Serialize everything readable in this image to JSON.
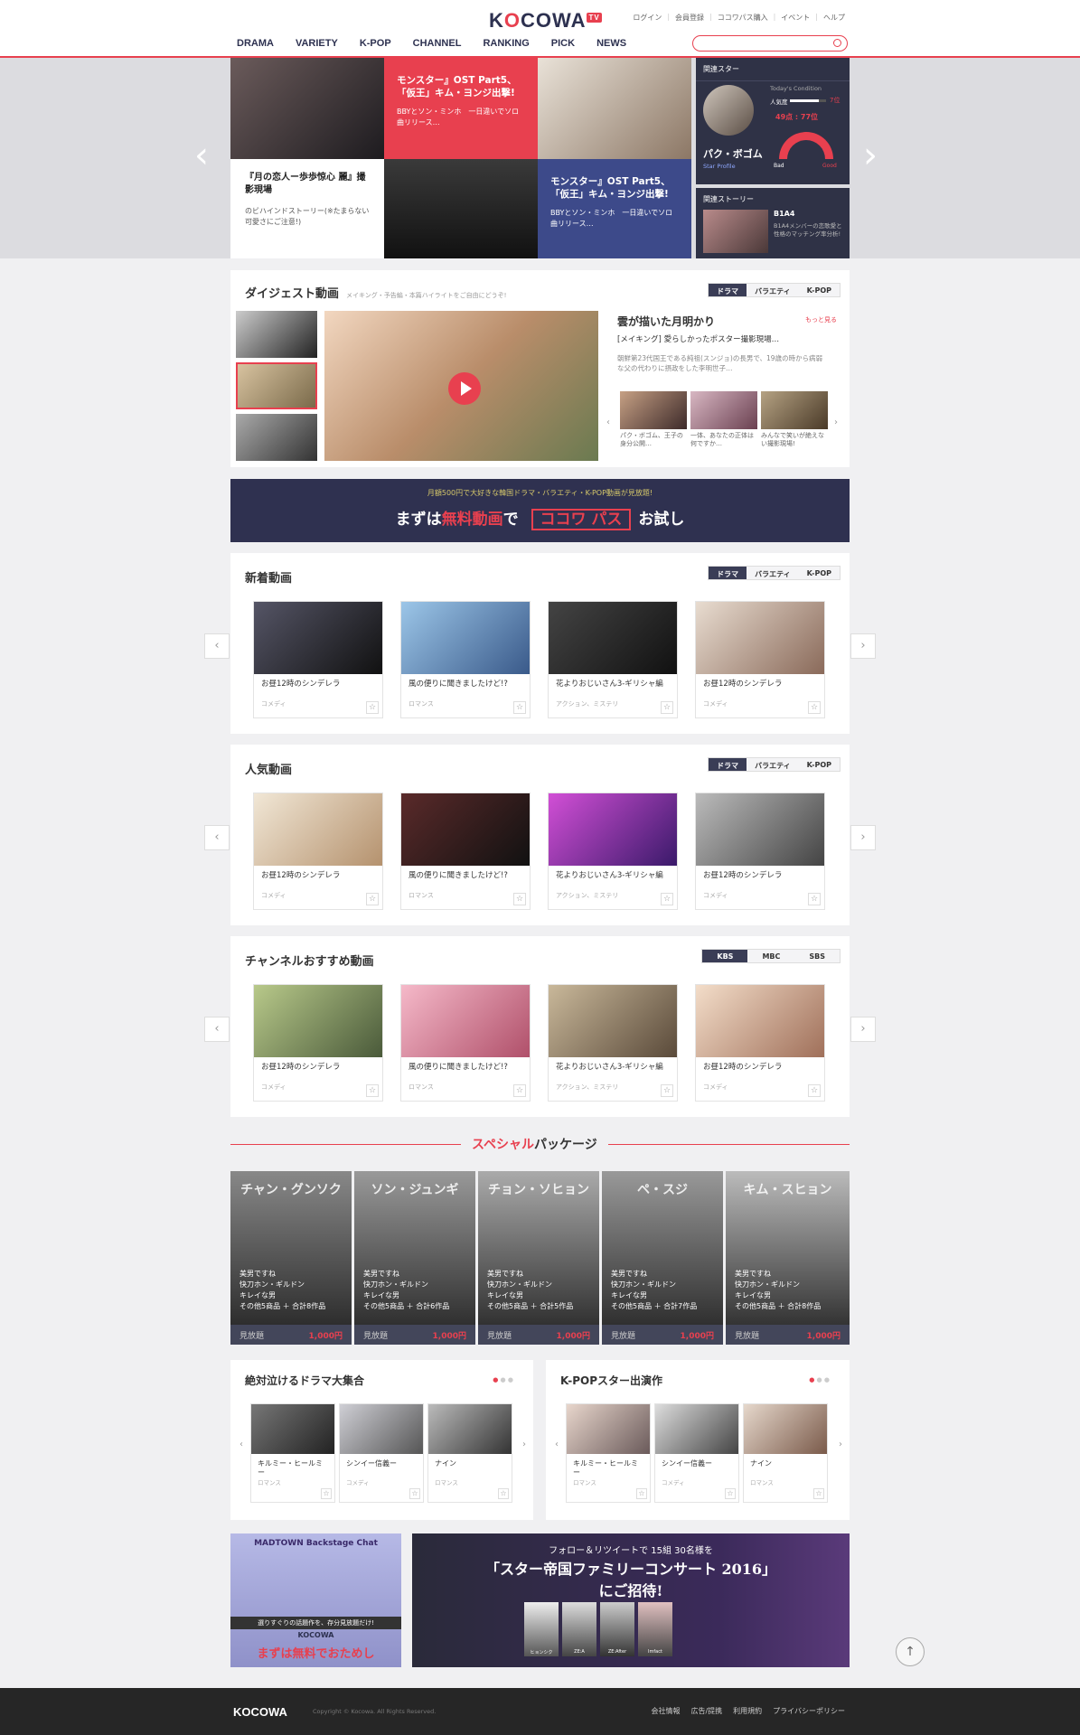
{
  "header": {
    "logo": "KOCOWA",
    "logo_badge": "TV",
    "top_links": [
      "ログイン",
      "会員登録",
      "ココワパス購入",
      "イベント",
      "ヘルプ"
    ],
    "nav": [
      "DRAMA",
      "VARIETY",
      "K-POP",
      "CHANNEL",
      "RANKING",
      "PICK",
      "NEWS"
    ],
    "search_placeholder": ""
  },
  "hero": {
    "tile1_title": "『月の恋人ー歩歩惊心 麗』撮影現場",
    "tile1_desc": "のビハインドストーリー(※たまらない可愛さにご注意!)",
    "tile2_title": "モンスター』OST Part5、「仮王」キム・ヨンジ出撃!",
    "tile2_desc": "BBYとソン・ミンホ　一日違いでソロ曲リリース…",
    "tile3_title": "モンスター』OST Part5、「仮王」キム・ヨンジ出撃!",
    "tile3_desc": "BBYとソン・ミンホ　一日違いでソロ曲リリース…",
    "star_label": "関連スター",
    "today": "Today's Condition",
    "pop": "人気度",
    "pop_val": "7位",
    "score": "49点 : 77位",
    "star_name": "パク・ボゴム",
    "profile": "Star Profile",
    "bad": "Bad",
    "good": "Good",
    "story_label": "関連ストーリー",
    "story_title": "B1A4",
    "story_desc": "B1A4メンバーの恋歌愛と性格のマッチング率分析!",
    "colors": {
      "red": "#e8404f",
      "blue": "#3d4a8a",
      "dark": "#2f3246"
    }
  },
  "digest": {
    "title": "ダイジェスト動画",
    "sub": "メイキング・予告編・本篇ハイライトをご自由にどうぞ!",
    "tabs": [
      "ドラマ",
      "バラエティ",
      "K-POP"
    ],
    "show": "雲が描いた月明かり",
    "more": "もっと見る",
    "making": "[メイキング] 愛らしかったポスター撮影現場…",
    "desc": "朝鮮第23代国王である純祖(スンジョ)の長男で、19歳の時から病弱な父の代わりに摂政をした李明世子…",
    "thumbs": [
      "パク・ボゴム、王子の身分公開…",
      "一体、あなたの正体は何ですか…",
      "みんなで笑いが絶えない撮影現場!"
    ]
  },
  "banner": {
    "top": "月額500円で大好きな韓国ドラマ・バラエティ・K-POP動画が見放題!",
    "pre": "まずは",
    "free": "無料動画",
    "mid": "で",
    "pass": "ココワ パス",
    "post": "お試し"
  },
  "new": {
    "title": "新着動画",
    "tabs": [
      "ドラマ",
      "バラエティ",
      "K-POP"
    ],
    "cards": [
      {
        "t": "お昼12時のシンデレラ",
        "g": "コメディ"
      },
      {
        "t": "風の便りに聞きましたけど!?",
        "g": "ロマンス"
      },
      {
        "t": "花よりおじいさん3-ギリシャ編",
        "g": "アクション、ミステリ"
      },
      {
        "t": "お昼12時のシンデレラ",
        "g": "コメディ"
      }
    ]
  },
  "popular": {
    "title": "人気動画",
    "tabs": [
      "ドラマ",
      "バラエティ",
      "K-POP"
    ],
    "cards": [
      {
        "t": "お昼12時のシンデレラ",
        "g": "コメディ"
      },
      {
        "t": "風の便りに聞きましたけど!?",
        "g": "ロマンス"
      },
      {
        "t": "花よりおじいさん3-ギリシャ編",
        "g": "アクション、ミステリ"
      },
      {
        "t": "お昼12時のシンデレラ",
        "g": "コメディ"
      }
    ]
  },
  "channel": {
    "title": "チャンネルおすすめ動画",
    "tabs": [
      "KBS",
      "MBC",
      "SBS"
    ],
    "cards": [
      {
        "t": "お昼12時のシンデレラ",
        "g": "コメディ"
      },
      {
        "t": "風の便りに聞きましたけど!?",
        "g": "ロマンス"
      },
      {
        "t": "花よりおじいさん3-ギリシャ編",
        "g": "アクション、ミステリ"
      },
      {
        "t": "お昼12時のシンデレラ",
        "g": "コメディ"
      }
    ]
  },
  "special": {
    "title_red": "スペシャル",
    "title_rest": "パッケージ",
    "pkgs": [
      {
        "name": "チャン・グンソク",
        "l1": "美男ですね",
        "l2": "快刀ホン・ギルドン",
        "l3": "キレイな男",
        "l4": "その他5商品 ＋ 合計8作品",
        "free": "見放題",
        "price": "1,000円"
      },
      {
        "name": "ソン・ジュンギ",
        "l1": "美男ですね",
        "l2": "快刀ホン・ギルドン",
        "l3": "キレイな男",
        "l4": "その他5商品 ＋ 合計6作品",
        "free": "見放題",
        "price": "1,000円"
      },
      {
        "name": "チョン・ソヒョン",
        "l1": "美男ですね",
        "l2": "快刀ホン・ギルドン",
        "l3": "キレイな男",
        "l4": "その他5商品 ＋ 合計5作品",
        "free": "見放題",
        "price": "1,000円"
      },
      {
        "name": "ペ・スジ",
        "l1": "美男ですね",
        "l2": "快刀ホン・ギルドン",
        "l3": "キレイな男",
        "l4": "その他5商品 ＋ 合計7作品",
        "free": "見放題",
        "price": "1,000円"
      },
      {
        "name": "キム・スヒョン",
        "l1": "美男ですね",
        "l2": "快刀ホン・ギルドン",
        "l3": "キレイな男",
        "l4": "その他5商品 ＋ 合計8作品",
        "free": "見放題",
        "price": "1,000円"
      }
    ]
  },
  "drama_set": {
    "title": "絶対泣けるドラマ大集合",
    "cards": [
      {
        "t": "キルミー・ヒールミー",
        "g": "ロマンス"
      },
      {
        "t": "シンイー信義ー",
        "g": "コメディ"
      },
      {
        "t": "ナイン",
        "g": "ロマンス"
      }
    ]
  },
  "kpop_set": {
    "title": "K-POPスター出演作",
    "cards": [
      {
        "t": "キルミー・ヒールミー",
        "g": "ロマンス"
      },
      {
        "t": "シンイー信義ー",
        "g": "コメディ"
      },
      {
        "t": "ナイン",
        "g": "ロマンス"
      }
    ]
  },
  "ads": {
    "left_top": "MADTOWN Backstage Chat",
    "left_mid": "選りすぐりの話題作を、存分見放題だけ!",
    "left_logo": "KOCOWA",
    "left_cta": "まずは無料でおためし",
    "right_top": "フォロー＆リツイートで 15組 30名様を",
    "right_main": "「スター帝国ファミリーコンサート 2016」",
    "right_sub": "にご招待!",
    "right_names": [
      "ヒョンシク",
      "ZE:A",
      "ZE:A",
      "ZE:After",
      "Imfact"
    ]
  },
  "footer": {
    "logo": "KOCOWA",
    "copy": "Copyright © Kocowa. All Rights Reserved.",
    "links": [
      "会社情報",
      "広告/提携",
      "利用規約",
      "プライバシーポリシー"
    ]
  }
}
